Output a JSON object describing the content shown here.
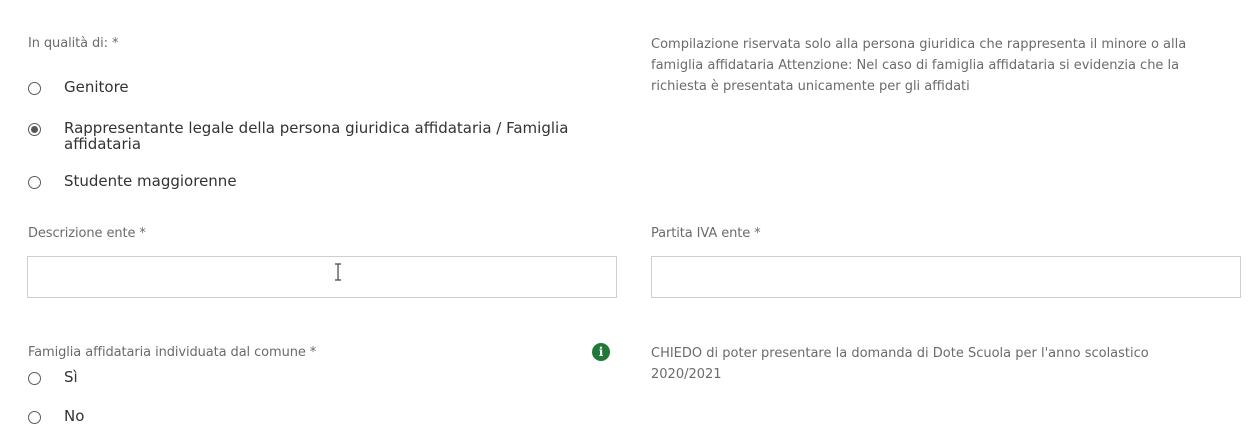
{
  "form": {
    "qualita": {
      "label": "In qualità di: *",
      "options": [
        {
          "label": "Genitore",
          "checked": false
        },
        {
          "label": "Rappresentante legale della persona giuridica affidataria / Famiglia affidataria",
          "checked": true
        },
        {
          "label": "Studente maggiorenne",
          "checked": false
        }
      ]
    },
    "note": "Compilazione riservata solo alla persona giuridica che rappresenta il minore o alla famiglia affidataria Attenzione: Nel caso di famiglia affidataria si evidenzia che la richiesta è presentata unicamente per gli affidati",
    "descrizione_ente": {
      "label": "Descrizione ente *",
      "value": ""
    },
    "partita_iva_ente": {
      "label": "Partita IVA ente *",
      "value": ""
    },
    "famiglia_affidataria": {
      "label": "Famiglia affidataria individuata dal comune *",
      "info_icon": "info-icon",
      "options": [
        {
          "label": "Sì",
          "checked": false
        },
        {
          "label": "No",
          "checked": false
        }
      ]
    },
    "chiedo": "CHIEDO di poter presentare la domanda di Dote Scuola per l'anno scolastico 2020/2021"
  },
  "colors": {
    "label": "#6b6b6b",
    "text": "#333333",
    "border": "#cfcfcf",
    "info_icon": "#1f7a3a"
  }
}
